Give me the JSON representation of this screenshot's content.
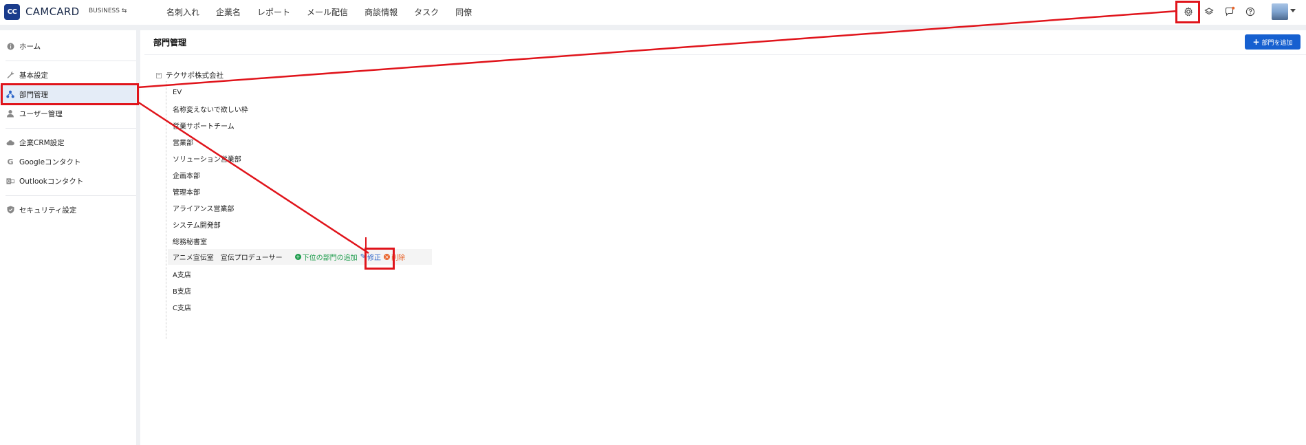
{
  "header": {
    "logo_mark": "CC",
    "app_name": "CAMCARD",
    "edition": "BUSINESS ⇆",
    "nav": [
      "名刺入れ",
      "企業名",
      "レポート",
      "メール配信",
      "商談情報",
      "タスク",
      "同僚"
    ]
  },
  "sidebar": {
    "items": [
      {
        "label": "ホーム",
        "icon": "info-icon"
      },
      {
        "label": "基本設定",
        "icon": "wrench-icon"
      },
      {
        "label": "部門管理",
        "icon": "org-chart-icon"
      },
      {
        "label": "ユーザー管理",
        "icon": "user-icon"
      },
      {
        "label": "企業CRM設定",
        "icon": "cloud-icon"
      },
      {
        "label": "Googleコンタクト",
        "icon": "google-icon"
      },
      {
        "label": "Outlookコンタクト",
        "icon": "outlook-icon"
      },
      {
        "label": "セキュリティ設定",
        "icon": "shield-icon"
      }
    ]
  },
  "main": {
    "title": "部門管理",
    "add_button": "部門を追加",
    "root": "テクサポ株式会社",
    "departments": [
      "EV",
      "名称変えないで欲しい枠",
      "営業サポートチーム",
      "営業部",
      "ソリューション営業部",
      "企画本部",
      "管理本部",
      "アライアンス営業部",
      "システム開発部",
      "総務秘書室",
      "アニメ宣伝室　宣伝プロデューサー",
      "A支店",
      "B支店",
      "C支店"
    ],
    "row_actions": {
      "add_sub": "下位の部門の追加",
      "edit": "修正",
      "delete": "削除"
    }
  },
  "colors": {
    "accent": "#1660d0",
    "annotation": "#e0141b",
    "add_action": "#1b9b4a",
    "delete_action": "#e8632a"
  }
}
